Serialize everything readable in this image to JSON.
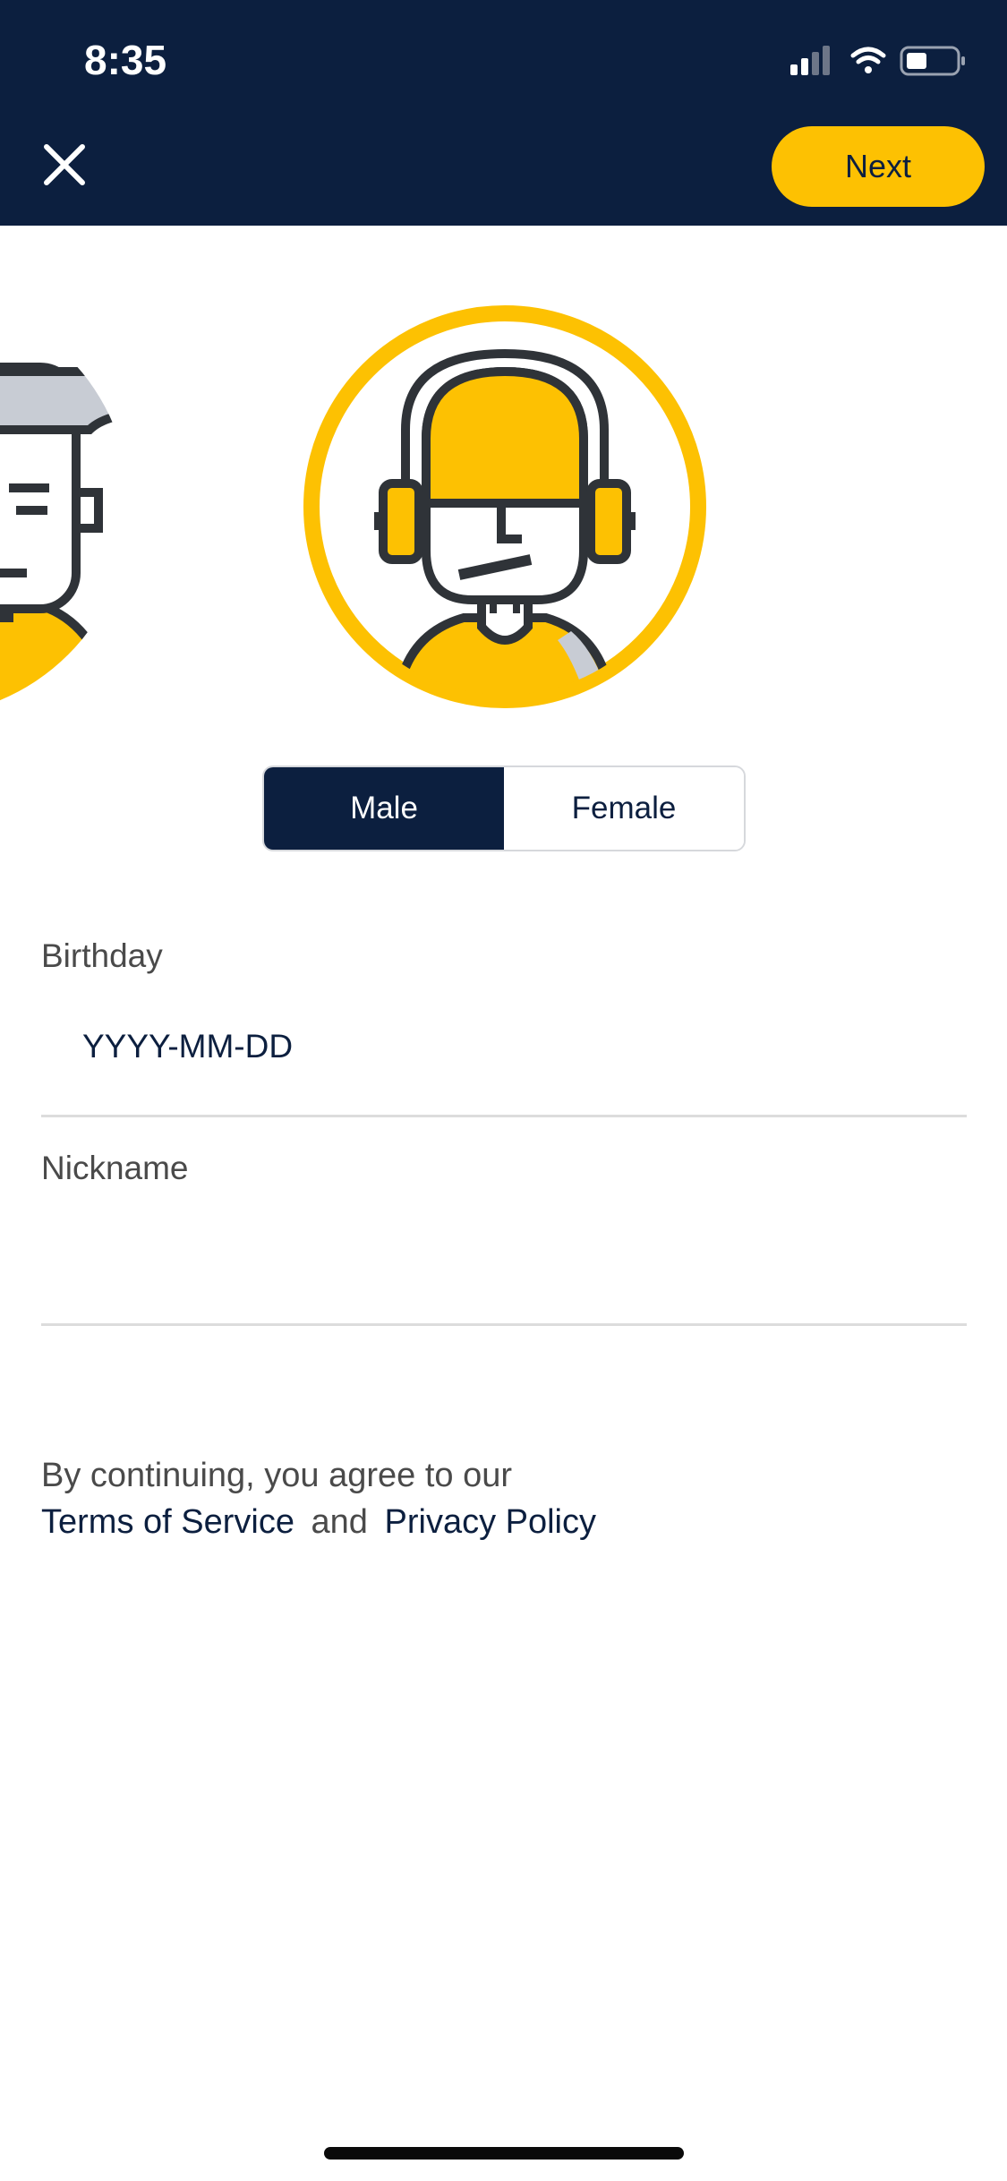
{
  "status_bar": {
    "time": "8:35"
  },
  "header": {
    "close_icon": "close-icon",
    "next_label": "Next"
  },
  "avatars": {
    "selected": "headphones-avatar",
    "others": [
      "boy-avatar"
    ]
  },
  "gender": {
    "options": [
      "Male",
      "Female"
    ],
    "selected": "Male"
  },
  "form": {
    "birthday_label": "Birthday",
    "birthday_placeholder": "YYYY-MM-DD",
    "nickname_label": "Nickname",
    "nickname_value": ""
  },
  "legal": {
    "prefix": "By continuing, you agree to our",
    "terms_link": "Terms of Service",
    "conjunction": "and",
    "privacy_link": "Privacy Policy"
  },
  "colors": {
    "primary_navy": "#0c1f3f",
    "accent_yellow": "#fdc102"
  }
}
